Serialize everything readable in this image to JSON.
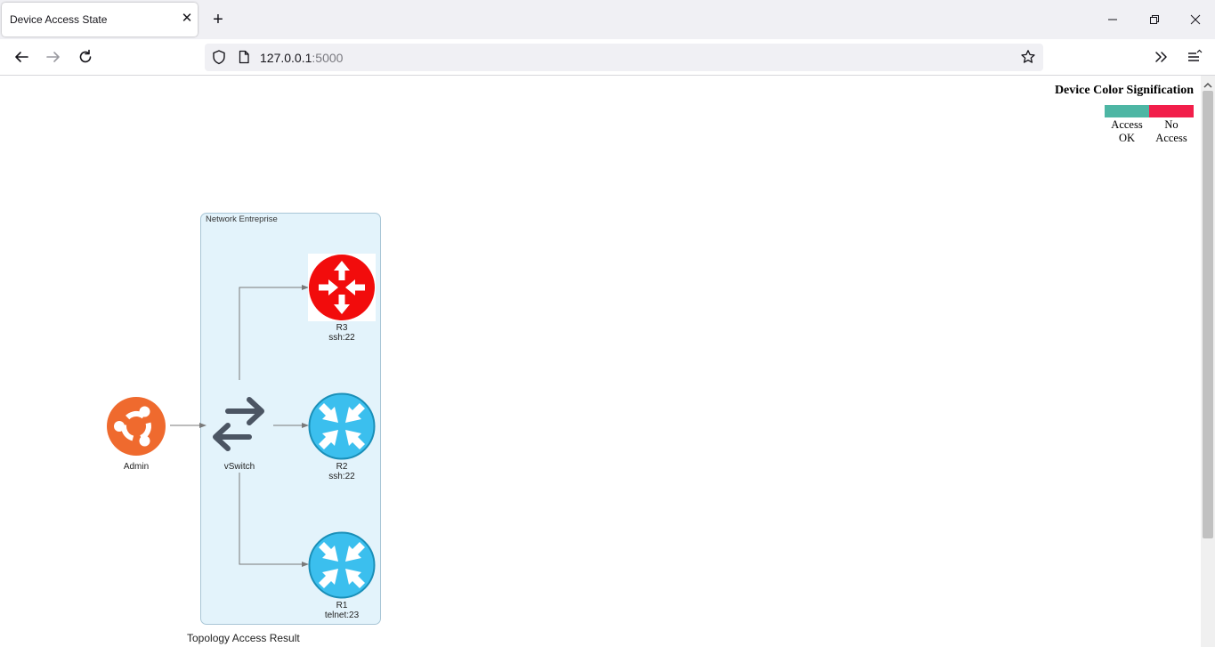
{
  "browser": {
    "tab_title": "Device Access State",
    "tab_close": "✕",
    "new_tab": "+",
    "url_host": "127.0.0.1",
    "url_port": ":5000"
  },
  "legend": {
    "title": "Device Color Signification",
    "items": [
      {
        "line1": "Access",
        "line2": "OK",
        "color": "#4db6a4"
      },
      {
        "line1": "No",
        "line2": "Access",
        "color": "#f21e4a"
      }
    ]
  },
  "diagram": {
    "cluster_label": "Network Entreprise",
    "nodes": {
      "admin": {
        "name": "Admin",
        "icon": "ubuntu-icon"
      },
      "vswitch": {
        "name": "vSwitch",
        "icon": "switch-arrows-icon"
      },
      "r3": {
        "name": "R3",
        "service": "ssh:22",
        "color": "#f20c0c",
        "icon": "router-icon"
      },
      "r2": {
        "name": "R2",
        "service": "ssh:22",
        "color": "#3bbfee",
        "icon": "router-icon"
      },
      "r1": {
        "name": "R1",
        "service": "telnet:23",
        "color": "#3bbfee",
        "icon": "router-icon"
      }
    },
    "caption": "Topology Access Result"
  },
  "colors": {
    "ubuntu_orange": "#ef6a2e",
    "switch_gray": "#4b5563",
    "edge_gray": "#7a7a7a",
    "cluster_fill": "#e3f3fb"
  }
}
